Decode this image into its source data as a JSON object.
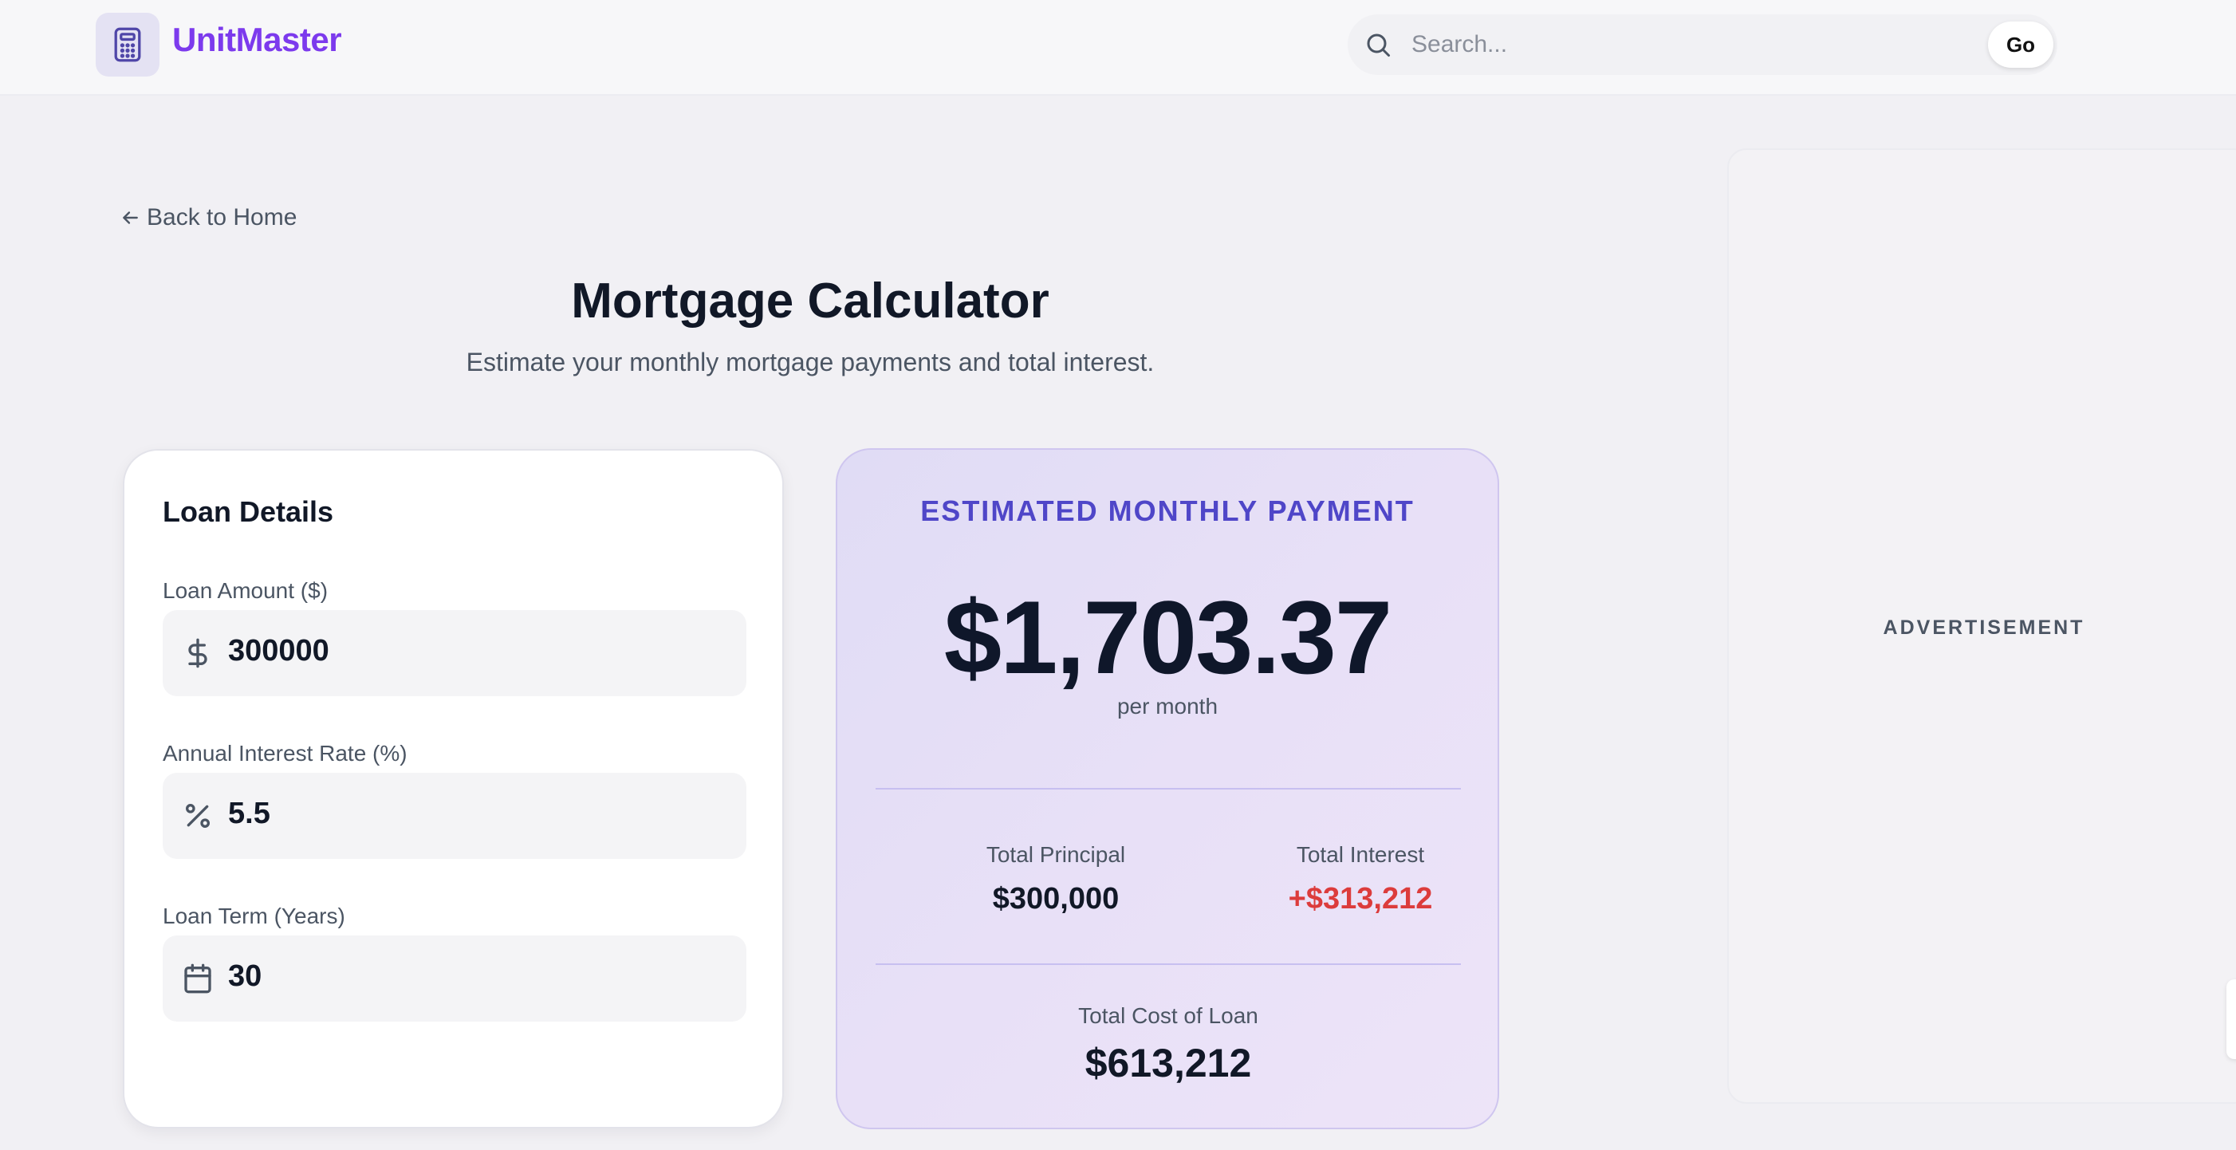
{
  "header": {
    "brand": "UnitMaster",
    "search_placeholder": "Search...",
    "go_label": "Go"
  },
  "nav": {
    "back_label": "Back to Home"
  },
  "page": {
    "title": "Mortgage Calculator",
    "subtitle": "Estimate your monthly mortgage payments and total interest."
  },
  "loan_details": {
    "heading": "Loan Details",
    "fields": [
      {
        "label": "Loan Amount ($)",
        "value": "300000",
        "icon": "dollar-icon"
      },
      {
        "label": "Annual Interest Rate (%)",
        "value": "5.5",
        "icon": "percent-icon"
      },
      {
        "label": "Loan Term (Years)",
        "value": "30",
        "icon": "calendar-icon"
      }
    ]
  },
  "result": {
    "heading": "ESTIMATED MONTHLY PAYMENT",
    "monthly_payment": "$1,703.37",
    "per_label": "per month",
    "total_principal_label": "Total Principal",
    "total_principal": "$300,000",
    "total_interest_label": "Total Interest",
    "total_interest": "+$313,212",
    "total_cost_label": "Total Cost of Loan",
    "total_cost": "$613,212"
  },
  "ad": {
    "label": "ADVERTISEMENT"
  },
  "colors": {
    "brand": "#7c3aed",
    "accent_heading": "#4f46c8",
    "interest": "#dc3c3c",
    "text_primary": "#111827",
    "text_secondary": "#4b5563"
  }
}
